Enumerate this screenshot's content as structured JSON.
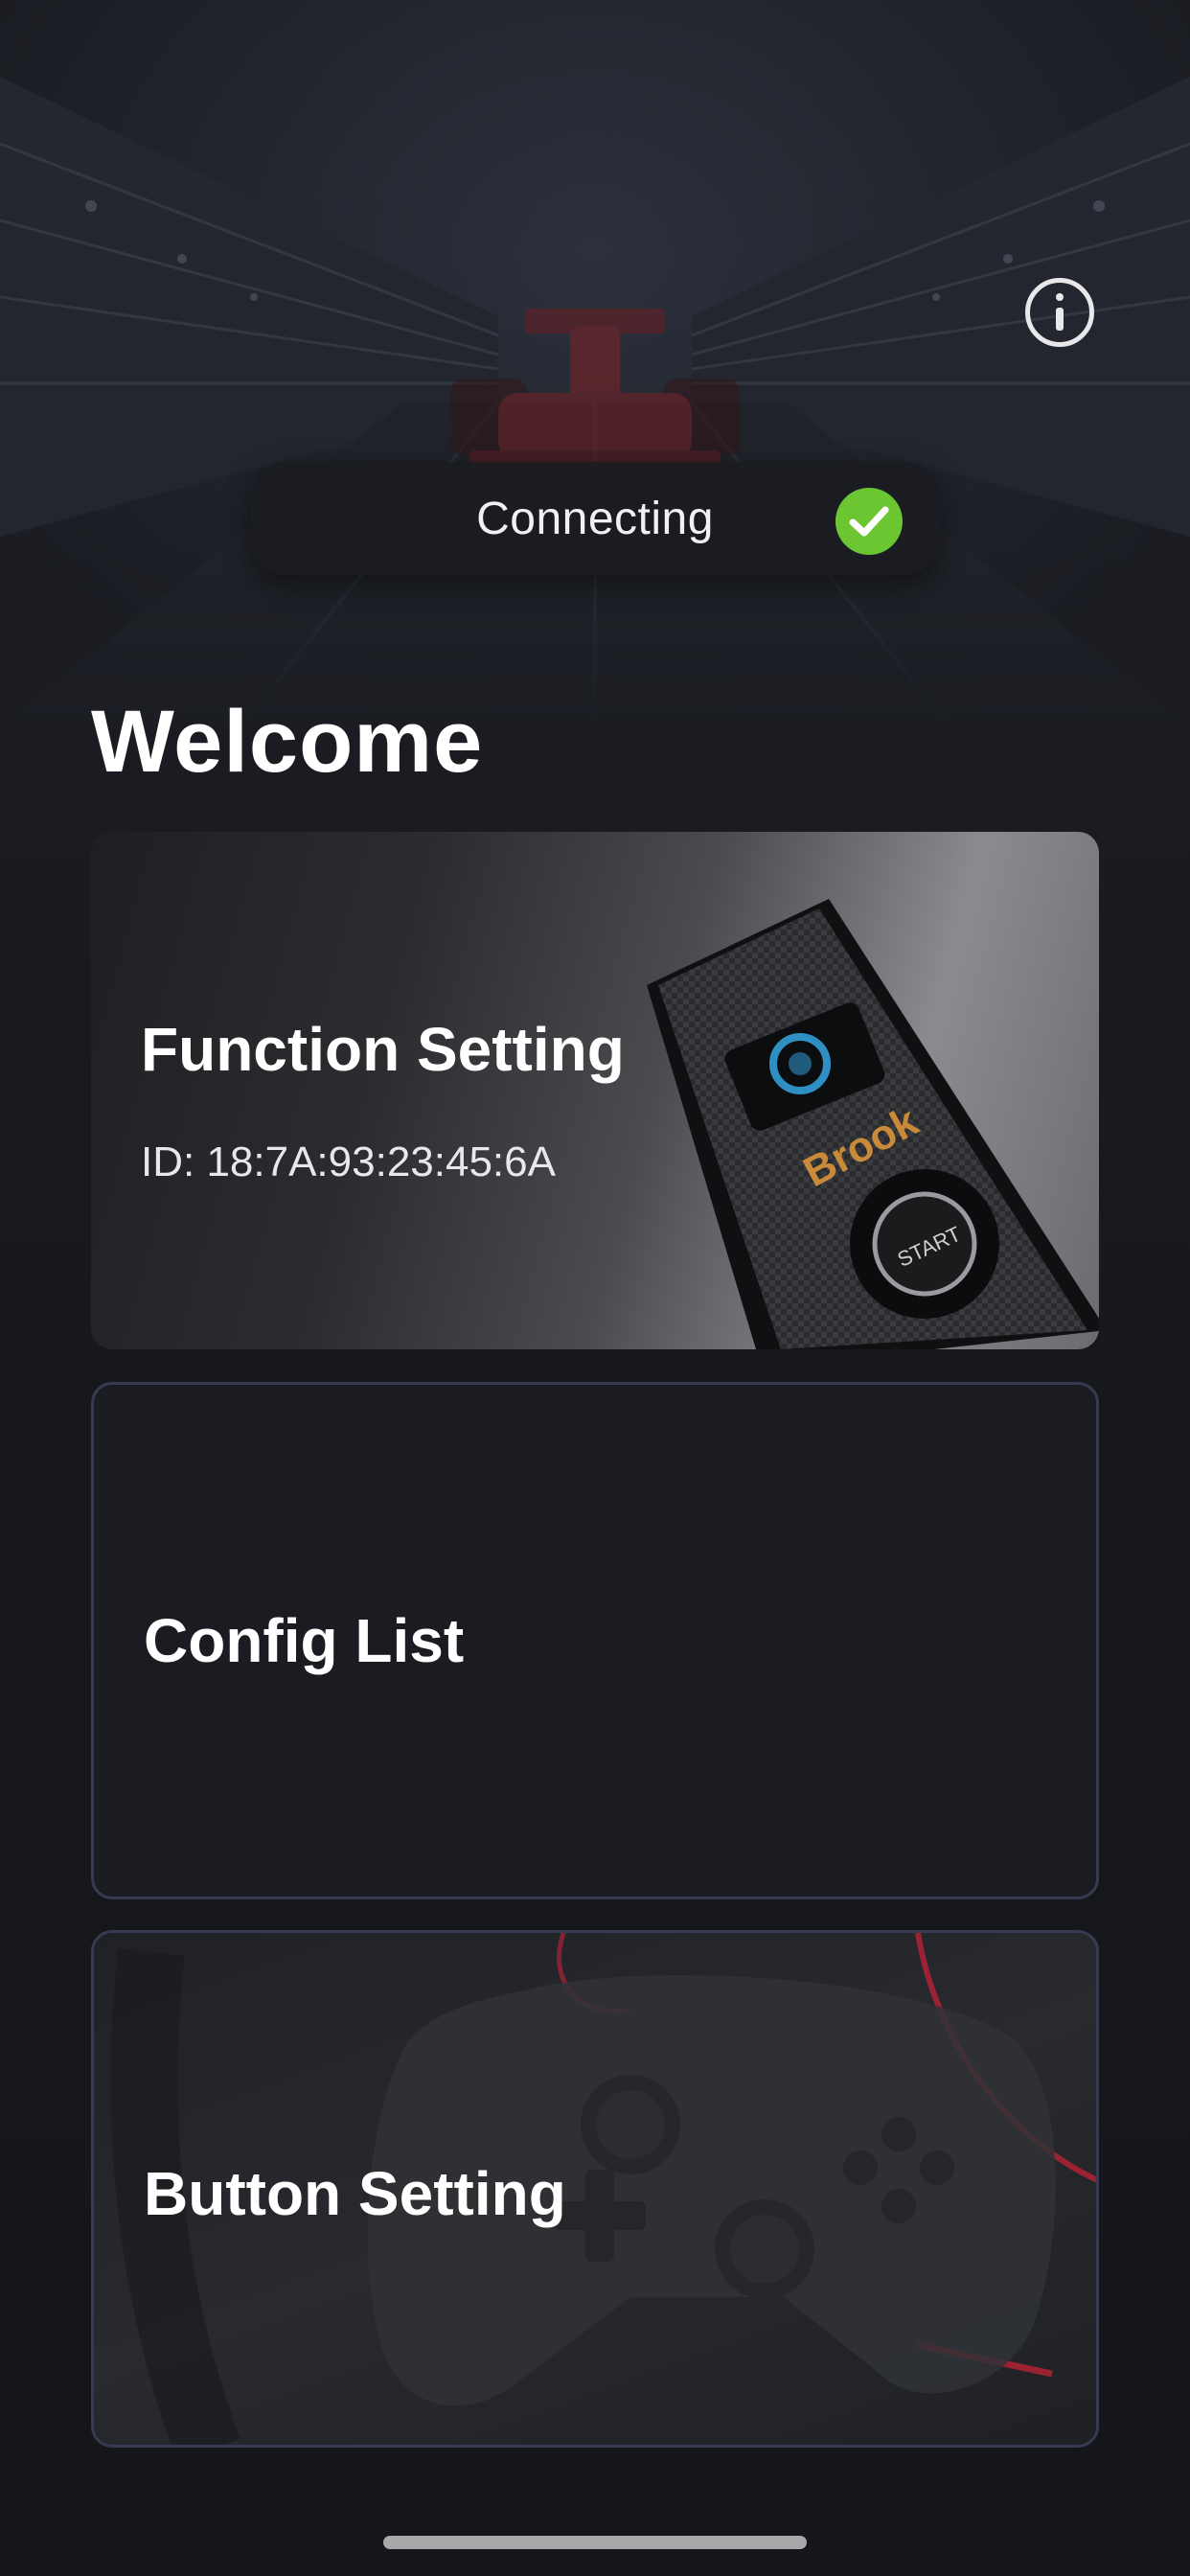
{
  "header": {
    "info_icon": "info-circle-icon",
    "connection_status": "Connecting",
    "status_icon": "check-circle-icon",
    "status_color": "#6cc631"
  },
  "main": {
    "title": "Welcome",
    "cards": [
      {
        "title": "Function Setting",
        "subtitle": "ID: 18:7A:93:23:45:6A",
        "image": "brook-device-image"
      },
      {
        "title": "Config List"
      },
      {
        "title": "Button Setting",
        "image": "game-controller-image"
      }
    ]
  },
  "device": {
    "brand_label": "Brook",
    "button_label": "START"
  },
  "colors": {
    "background": "#17181c",
    "card_border": "#363a52",
    "accent_red": "#c8263a"
  }
}
